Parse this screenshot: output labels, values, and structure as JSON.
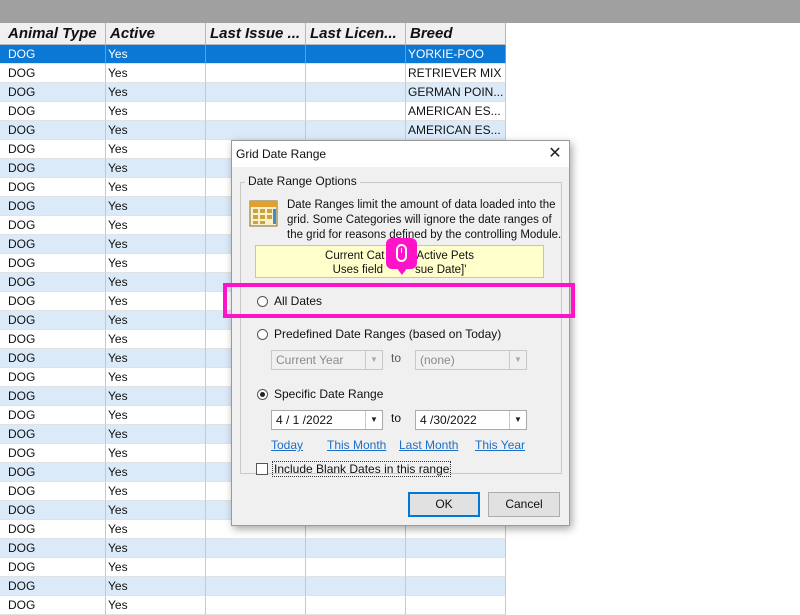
{
  "grid": {
    "columns": [
      "Animal Type",
      "Active",
      "Last Issue ...",
      "Last Licen...",
      "Breed"
    ],
    "rows": [
      {
        "animal_type": "DOG",
        "active": "Yes",
        "last_issue": "",
        "last_license": "",
        "breed": "YORKIE-POO",
        "selected": true
      },
      {
        "animal_type": "DOG",
        "active": "Yes",
        "last_issue": "",
        "last_license": "",
        "breed": "RETRIEVER MIX"
      },
      {
        "animal_type": "DOG",
        "active": "Yes",
        "last_issue": "",
        "last_license": "",
        "breed": "GERMAN POIN..."
      },
      {
        "animal_type": "DOG",
        "active": "Yes",
        "last_issue": "",
        "last_license": "",
        "breed": "AMERICAN ES..."
      },
      {
        "animal_type": "DOG",
        "active": "Yes",
        "last_issue": "",
        "last_license": "",
        "breed": "AMERICAN ES..."
      },
      {
        "animal_type": "DOG",
        "active": "Yes",
        "last_issue": "",
        "last_license": "",
        "breed": ""
      },
      {
        "animal_type": "DOG",
        "active": "Yes",
        "last_issue": "",
        "last_license": "",
        "breed": ""
      },
      {
        "animal_type": "DOG",
        "active": "Yes",
        "last_issue": "",
        "last_license": "",
        "breed": ""
      },
      {
        "animal_type": "DOG",
        "active": "Yes",
        "last_issue": "",
        "last_license": "",
        "breed": ""
      },
      {
        "animal_type": "DOG",
        "active": "Yes",
        "last_issue": "",
        "last_license": "",
        "breed": ""
      },
      {
        "animal_type": "DOG",
        "active": "Yes",
        "last_issue": "",
        "last_license": "",
        "breed": ""
      },
      {
        "animal_type": "DOG",
        "active": "Yes",
        "last_issue": "",
        "last_license": "",
        "breed": ""
      },
      {
        "animal_type": "DOG",
        "active": "Yes",
        "last_issue": "",
        "last_license": "",
        "breed": ""
      },
      {
        "animal_type": "DOG",
        "active": "Yes",
        "last_issue": "",
        "last_license": "",
        "breed": ""
      },
      {
        "animal_type": "DOG",
        "active": "Yes",
        "last_issue": "",
        "last_license": "",
        "breed": ""
      },
      {
        "animal_type": "DOG",
        "active": "Yes",
        "last_issue": "",
        "last_license": "",
        "breed": ""
      },
      {
        "animal_type": "DOG",
        "active": "Yes",
        "last_issue": "",
        "last_license": "",
        "breed": ""
      },
      {
        "animal_type": "DOG",
        "active": "Yes",
        "last_issue": "",
        "last_license": "",
        "breed": ""
      },
      {
        "animal_type": "DOG",
        "active": "Yes",
        "last_issue": "",
        "last_license": "",
        "breed": ""
      },
      {
        "animal_type": "DOG",
        "active": "Yes",
        "last_issue": "",
        "last_license": "",
        "breed": ""
      },
      {
        "animal_type": "DOG",
        "active": "Yes",
        "last_issue": "",
        "last_license": "",
        "breed": ""
      },
      {
        "animal_type": "DOG",
        "active": "Yes",
        "last_issue": "",
        "last_license": "",
        "breed": ""
      },
      {
        "animal_type": "DOG",
        "active": "Yes",
        "last_issue": "",
        "last_license": "",
        "breed": ""
      },
      {
        "animal_type": "DOG",
        "active": "Yes",
        "last_issue": "",
        "last_license": "",
        "breed": ""
      },
      {
        "animal_type": "DOG",
        "active": "Yes",
        "last_issue": "",
        "last_license": "",
        "breed": ""
      },
      {
        "animal_type": "DOG",
        "active": "Yes",
        "last_issue": "",
        "last_license": "",
        "breed": ""
      },
      {
        "animal_type": "DOG",
        "active": "Yes",
        "last_issue": "",
        "last_license": "",
        "breed": ""
      },
      {
        "animal_type": "DOG",
        "active": "Yes",
        "last_issue": "",
        "last_license": "",
        "breed": ""
      },
      {
        "animal_type": "DOG",
        "active": "Yes",
        "last_issue": "",
        "last_license": "",
        "breed": ""
      },
      {
        "animal_type": "DOG",
        "active": "Yes",
        "last_issue": "",
        "last_license": "",
        "breed": ""
      }
    ]
  },
  "dialog": {
    "title": "Grid Date Range",
    "close_glyph": "✕",
    "group_label": "Date Range Options",
    "info_text": "Date Ranges limit the amount of data loaded into the grid. Some Categories will ignore the date ranges of the grid for reasons defined by the controlling Module.",
    "category_line1": "Current Cat          Active Pets",
    "category_line2": "Uses field          sue Date]'",
    "option_all_dates": "All Dates",
    "option_predefined": "Predefined Date Ranges (based on Today)",
    "predefined_from": "Current Year",
    "predefined_to": "(none)",
    "to_label": "to",
    "option_specific": "Specific Date Range",
    "specific_from": "4 / 1 /2022",
    "specific_to": "4 /30/2022",
    "selected_option": "specific",
    "links": [
      "Today",
      "This Month",
      "Last Month",
      "This Year"
    ],
    "include_blank_label": "Include Blank Dates in this range",
    "include_blank_checked": false,
    "ok_label": "OK",
    "cancel_label": "Cancel"
  },
  "colors": {
    "highlight": "#ff13c8",
    "selected_row": "#0a78d4",
    "alt_row": "#dbeaf9",
    "link": "#1c6fc7",
    "category_box": "#ffffcc"
  },
  "icons": [
    "calendar-icon",
    "close-icon",
    "mouse-icon",
    "dropdown-arrow-icon"
  ]
}
